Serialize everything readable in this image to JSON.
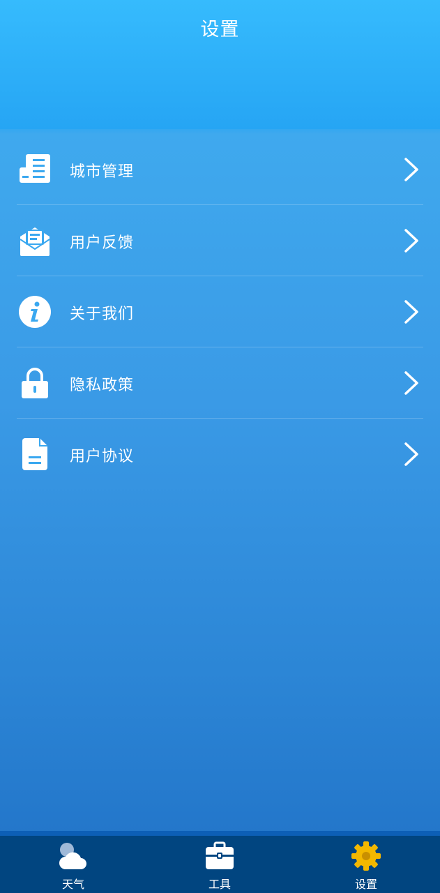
{
  "header": {
    "title": "设置"
  },
  "menu": {
    "items": [
      {
        "label": "城市管理",
        "icon": "city-management-icon"
      },
      {
        "label": "用户反馈",
        "icon": "feedback-envelope-icon"
      },
      {
        "label": "关于我们",
        "icon": "info-icon"
      },
      {
        "label": "隐私政策",
        "icon": "lock-icon"
      },
      {
        "label": "用户协议",
        "icon": "document-icon"
      }
    ]
  },
  "tabbar": {
    "tabs": [
      {
        "label": "天气",
        "icon": "weather-cloud-icon"
      },
      {
        "label": "工具",
        "icon": "toolbox-icon"
      },
      {
        "label": "设置",
        "icon": "gear-icon",
        "active": true
      }
    ],
    "active_color": "#f3b800"
  }
}
